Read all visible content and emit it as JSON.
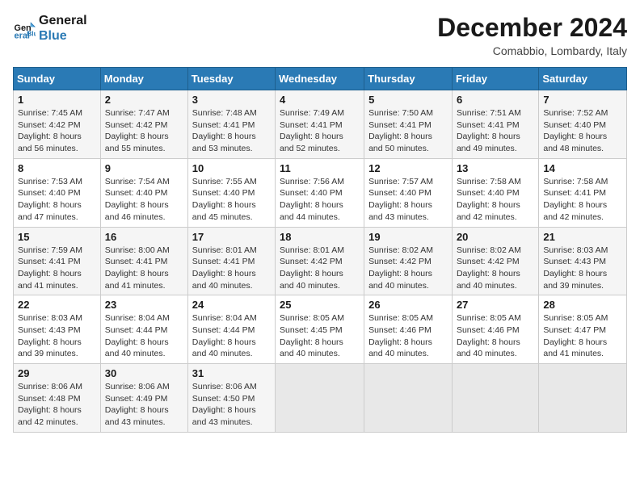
{
  "logo": {
    "line1": "General",
    "line2": "Blue"
  },
  "title": "December 2024",
  "subtitle": "Comabbio, Lombardy, Italy",
  "headers": [
    "Sunday",
    "Monday",
    "Tuesday",
    "Wednesday",
    "Thursday",
    "Friday",
    "Saturday"
  ],
  "weeks": [
    [
      {
        "day": "1",
        "sunrise": "7:45 AM",
        "sunset": "4:42 PM",
        "daylight": "8 hours and 56 minutes."
      },
      {
        "day": "2",
        "sunrise": "7:47 AM",
        "sunset": "4:42 PM",
        "daylight": "8 hours and 55 minutes."
      },
      {
        "day": "3",
        "sunrise": "7:48 AM",
        "sunset": "4:41 PM",
        "daylight": "8 hours and 53 minutes."
      },
      {
        "day": "4",
        "sunrise": "7:49 AM",
        "sunset": "4:41 PM",
        "daylight": "8 hours and 52 minutes."
      },
      {
        "day": "5",
        "sunrise": "7:50 AM",
        "sunset": "4:41 PM",
        "daylight": "8 hours and 50 minutes."
      },
      {
        "day": "6",
        "sunrise": "7:51 AM",
        "sunset": "4:41 PM",
        "daylight": "8 hours and 49 minutes."
      },
      {
        "day": "7",
        "sunrise": "7:52 AM",
        "sunset": "4:40 PM",
        "daylight": "8 hours and 48 minutes."
      }
    ],
    [
      {
        "day": "8",
        "sunrise": "7:53 AM",
        "sunset": "4:40 PM",
        "daylight": "8 hours and 47 minutes."
      },
      {
        "day": "9",
        "sunrise": "7:54 AM",
        "sunset": "4:40 PM",
        "daylight": "8 hours and 46 minutes."
      },
      {
        "day": "10",
        "sunrise": "7:55 AM",
        "sunset": "4:40 PM",
        "daylight": "8 hours and 45 minutes."
      },
      {
        "day": "11",
        "sunrise": "7:56 AM",
        "sunset": "4:40 PM",
        "daylight": "8 hours and 44 minutes."
      },
      {
        "day": "12",
        "sunrise": "7:57 AM",
        "sunset": "4:40 PM",
        "daylight": "8 hours and 43 minutes."
      },
      {
        "day": "13",
        "sunrise": "7:58 AM",
        "sunset": "4:40 PM",
        "daylight": "8 hours and 42 minutes."
      },
      {
        "day": "14",
        "sunrise": "7:58 AM",
        "sunset": "4:41 PM",
        "daylight": "8 hours and 42 minutes."
      }
    ],
    [
      {
        "day": "15",
        "sunrise": "7:59 AM",
        "sunset": "4:41 PM",
        "daylight": "8 hours and 41 minutes."
      },
      {
        "day": "16",
        "sunrise": "8:00 AM",
        "sunset": "4:41 PM",
        "daylight": "8 hours and 41 minutes."
      },
      {
        "day": "17",
        "sunrise": "8:01 AM",
        "sunset": "4:41 PM",
        "daylight": "8 hours and 40 minutes."
      },
      {
        "day": "18",
        "sunrise": "8:01 AM",
        "sunset": "4:42 PM",
        "daylight": "8 hours and 40 minutes."
      },
      {
        "day": "19",
        "sunrise": "8:02 AM",
        "sunset": "4:42 PM",
        "daylight": "8 hours and 40 minutes."
      },
      {
        "day": "20",
        "sunrise": "8:02 AM",
        "sunset": "4:42 PM",
        "daylight": "8 hours and 40 minutes."
      },
      {
        "day": "21",
        "sunrise": "8:03 AM",
        "sunset": "4:43 PM",
        "daylight": "8 hours and 39 minutes."
      }
    ],
    [
      {
        "day": "22",
        "sunrise": "8:03 AM",
        "sunset": "4:43 PM",
        "daylight": "8 hours and 39 minutes."
      },
      {
        "day": "23",
        "sunrise": "8:04 AM",
        "sunset": "4:44 PM",
        "daylight": "8 hours and 40 minutes."
      },
      {
        "day": "24",
        "sunrise": "8:04 AM",
        "sunset": "4:44 PM",
        "daylight": "8 hours and 40 minutes."
      },
      {
        "day": "25",
        "sunrise": "8:05 AM",
        "sunset": "4:45 PM",
        "daylight": "8 hours and 40 minutes."
      },
      {
        "day": "26",
        "sunrise": "8:05 AM",
        "sunset": "4:46 PM",
        "daylight": "8 hours and 40 minutes."
      },
      {
        "day": "27",
        "sunrise": "8:05 AM",
        "sunset": "4:46 PM",
        "daylight": "8 hours and 40 minutes."
      },
      {
        "day": "28",
        "sunrise": "8:05 AM",
        "sunset": "4:47 PM",
        "daylight": "8 hours and 41 minutes."
      }
    ],
    [
      {
        "day": "29",
        "sunrise": "8:06 AM",
        "sunset": "4:48 PM",
        "daylight": "8 hours and 42 minutes."
      },
      {
        "day": "30",
        "sunrise": "8:06 AM",
        "sunset": "4:49 PM",
        "daylight": "8 hours and 43 minutes."
      },
      {
        "day": "31",
        "sunrise": "8:06 AM",
        "sunset": "4:50 PM",
        "daylight": "8 hours and 43 minutes."
      },
      null,
      null,
      null,
      null
    ]
  ],
  "labels": {
    "sunrise": "Sunrise:",
    "sunset": "Sunset:",
    "daylight": "Daylight:"
  }
}
